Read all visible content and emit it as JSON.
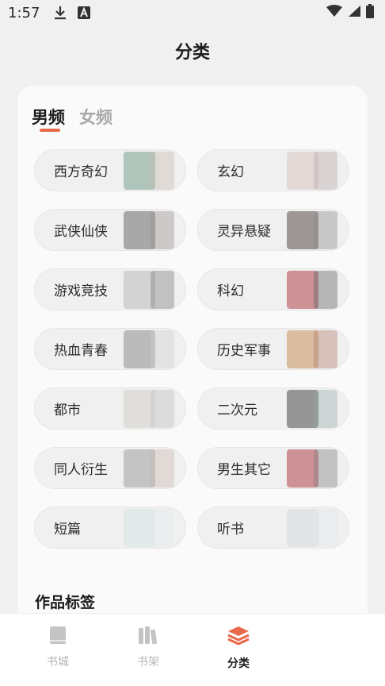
{
  "status_bar": {
    "time": "1:57",
    "left_icons": [
      "download-icon",
      "a-box-icon"
    ],
    "right_icons": [
      "wifi-icon",
      "signal-icon",
      "battery-icon"
    ]
  },
  "page": {
    "title": "分类"
  },
  "tabs": [
    {
      "label": "男频",
      "active": true
    },
    {
      "label": "女频",
      "active": false
    }
  ],
  "accent_color": "#e8684a",
  "categories": [
    {
      "label": "西方奇幻",
      "cover_colors": [
        "#7aa38f",
        "#c9b9b0"
      ]
    },
    {
      "label": "玄幻",
      "cover_colors": [
        "#d9c9c4",
        "#b9a8a8"
      ]
    },
    {
      "label": "武侠仙侠",
      "cover_colors": [
        "#6d6d6d",
        "#9a8f8f"
      ]
    },
    {
      "label": "灵异悬疑",
      "cover_colors": [
        "#5a4f4a",
        "#8c8c8c"
      ]
    },
    {
      "label": "游戏竞技",
      "cover_colors": [
        "#bcbcbc",
        "#7a7a7a"
      ]
    },
    {
      "label": "科幻",
      "cover_colors": [
        "#b0454a",
        "#5f5f5f"
      ]
    },
    {
      "label": "热血青春",
      "cover_colors": [
        "#8f8f8f",
        "#cfcfcf"
      ]
    },
    {
      "label": "历史军事",
      "cover_colors": [
        "#c9935c",
        "#b27a6a"
      ]
    },
    {
      "label": "都市",
      "cover_colors": [
        "#d4d0c8",
        "#bdbdbd"
      ]
    },
    {
      "label": "二次元",
      "cover_colors": [
        "#4a4a4a",
        "#97a9a9"
      ]
    },
    {
      "label": "同人衍生",
      "cover_colors": [
        "#a0a0a0",
        "#c7b7b0"
      ]
    },
    {
      "label": "男生其它",
      "cover_colors": [
        "#b2444a",
        "#7d7d7d"
      ]
    },
    {
      "label": "短篇",
      "cover_colors": [
        "#d8e3e3",
        "#e3eaea"
      ]
    },
    {
      "label": "听书",
      "cover_colors": [
        "#d5dde0",
        "#e2e6e8"
      ]
    }
  ],
  "section": {
    "label": "作品标签"
  },
  "bottom_nav": [
    {
      "label": "书城",
      "icon": "book-icon",
      "active": false
    },
    {
      "label": "书架",
      "icon": "bookshelf-icon",
      "active": false
    },
    {
      "label": "分类",
      "icon": "layers-icon",
      "active": true
    }
  ]
}
